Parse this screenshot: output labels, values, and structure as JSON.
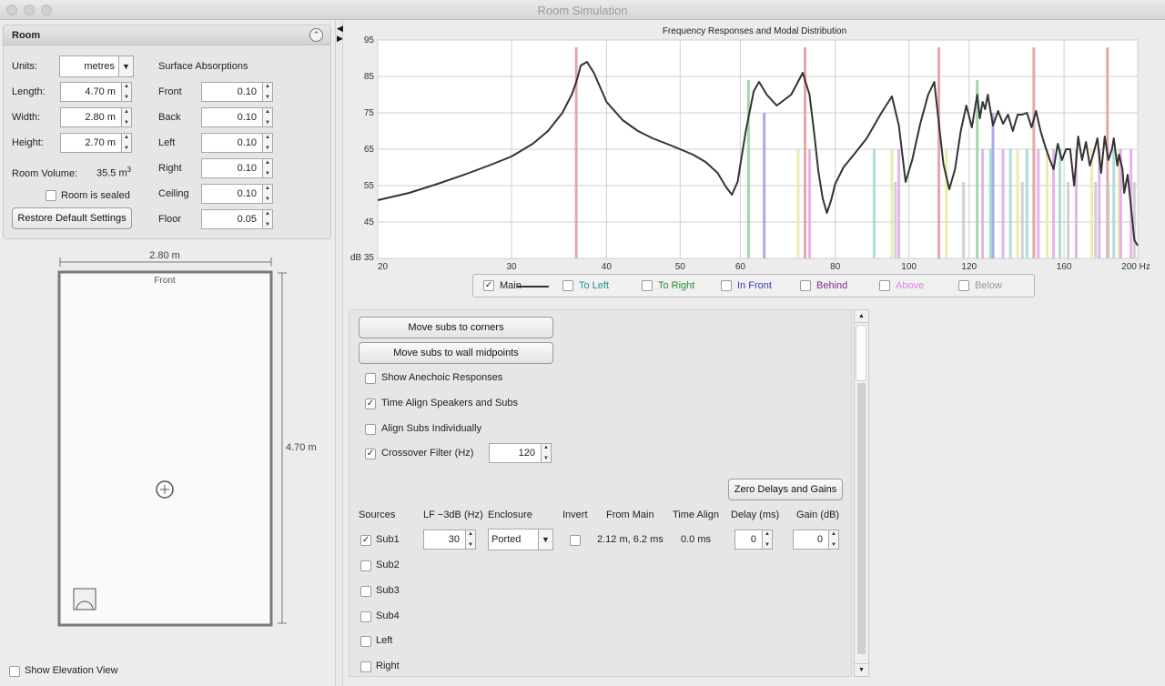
{
  "window": {
    "title": "Room Simulation"
  },
  "room": {
    "header": "Room",
    "units_label": "Units:",
    "units_value": "metres",
    "length_label": "Length:",
    "length_value": "4.70 m",
    "width_label": "Width:",
    "width_value": "2.80 m",
    "height_label": "Height:",
    "height_value": "2.70 m",
    "volume_label": "Room Volume:",
    "volume_value": "35.5 m",
    "volume_exp": "3",
    "sealed_label": "Room is sealed",
    "restore_label": "Restore Default Settings",
    "absorption_title": "Surface Absorptions",
    "surfaces": [
      {
        "label": "Front",
        "value": "0.10"
      },
      {
        "label": "Back",
        "value": "0.10"
      },
      {
        "label": "Left",
        "value": "0.10"
      },
      {
        "label": "Right",
        "value": "0.10"
      },
      {
        "label": "Ceiling",
        "value": "0.10"
      },
      {
        "label": "Floor",
        "value": "0.05"
      }
    ]
  },
  "plan": {
    "width_dim": "2.80 m",
    "length_dim": "4.70 m",
    "front_label": "Front",
    "elevation_label": "Show Elevation View"
  },
  "chart_data": {
    "type": "line",
    "title": "Frequency Responses and Modal Distribution",
    "xscale": "log",
    "xlim": [
      20,
      200
    ],
    "ylim": [
      35,
      95
    ],
    "x_ticks": [
      "20",
      "30",
      "40",
      "50",
      "60",
      "80",
      "100",
      "120",
      "160",
      "200 Hz"
    ],
    "x_tick_values": [
      20,
      30,
      40,
      50,
      60,
      80,
      100,
      120,
      160,
      200
    ],
    "y_ticks": [
      "dB 35",
      "45",
      "55",
      "65",
      "75",
      "85",
      "95"
    ],
    "y_tick_values": [
      35,
      45,
      55,
      65,
      75,
      85,
      95
    ],
    "grid": true,
    "series": [
      {
        "name": "Main",
        "x": [
          20,
          22,
          24,
          26,
          28,
          30,
          32,
          33.5,
          35,
          36,
          36.5,
          37,
          37.7,
          38.5,
          40,
          42,
          44,
          46,
          48,
          50,
          52,
          54,
          56,
          57.5,
          58.5,
          59.5,
          61,
          62.5,
          63.5,
          65,
          67,
          70,
          72.5,
          74,
          75,
          76,
          77,
          78,
          79,
          80,
          82,
          85,
          88,
          92,
          95,
          97,
          99,
          101,
          103.5,
          106,
          108,
          109.5,
          111,
          113,
          115,
          117,
          119,
          121,
          123,
          124,
          125,
          126,
          127,
          129,
          131,
          133,
          135,
          137,
          139,
          141,
          143,
          145,
          147,
          149,
          151,
          153,
          155,
          157,
          159,
          161,
          163,
          165,
          167,
          169,
          171,
          173,
          175,
          177,
          179,
          181,
          183,
          185,
          186,
          188,
          189,
          191,
          192,
          194,
          196,
          198,
          200
        ],
        "y": [
          51,
          53,
          55.5,
          58,
          60.5,
          63,
          66.5,
          70,
          75,
          80,
          83.5,
          88,
          89,
          86,
          78,
          73,
          70,
          68,
          66.5,
          65,
          63.5,
          61.5,
          58.5,
          54.5,
          52.5,
          56,
          70,
          81,
          83.5,
          80,
          77,
          80,
          86,
          80,
          70,
          59,
          51.5,
          47.5,
          51,
          55.5,
          60,
          64,
          68,
          75,
          79.5,
          71.5,
          56,
          62,
          72,
          80,
          83.5,
          72,
          61,
          54,
          59.5,
          70,
          77,
          71,
          80,
          73.5,
          78,
          76,
          80,
          71.5,
          75.5,
          72,
          74.5,
          70,
          74.5,
          74.5,
          75,
          71,
          75.5,
          70,
          66,
          62.5,
          59.5,
          66.5,
          62,
          65,
          65,
          55,
          68.5,
          62,
          67,
          60.5,
          64,
          68,
          58.5,
          68.5,
          62,
          65,
          68,
          60.5,
          63.5,
          59.5,
          53,
          58,
          49,
          40,
          38.5
        ]
      }
    ],
    "modal_lines": [
      {
        "color": "#e29a9a",
        "x": [
          36.5,
          73,
          109.5,
          146,
          182.5
        ]
      },
      {
        "color": "#93d19c",
        "x": [
          61.5,
          123
        ]
      },
      {
        "color": "#9c9ce6",
        "x": [
          64.5,
          129
        ]
      },
      {
        "color": "#ebe8a2",
        "x": [
          71.5,
          95,
          112,
          139,
          152,
          174,
          189
        ]
      },
      {
        "color": "#e1a7e8",
        "x": [
          74,
          97,
          125,
          133,
          148,
          155,
          166,
          178,
          190,
          196
        ]
      },
      {
        "color": "#9fd9d3",
        "x": [
          90,
          128,
          136,
          143,
          158,
          186
        ]
      },
      {
        "color": "#c9c9c9",
        "x": [
          96,
          118,
          141,
          162,
          176,
          183,
          198
        ]
      }
    ],
    "legend": [
      {
        "label": "Main",
        "checked": true,
        "color": "#333333"
      },
      {
        "label": "To Left",
        "checked": false,
        "color": "#2a8a9a"
      },
      {
        "label": "To Right",
        "checked": false,
        "color": "#2a8a3a"
      },
      {
        "label": "In Front",
        "checked": false,
        "color": "#3a3ab8"
      },
      {
        "label": "Behind",
        "checked": false,
        "color": "#8a2a9a"
      },
      {
        "label": "Above",
        "checked": false,
        "color": "#e085e8"
      },
      {
        "label": "Below",
        "checked": false,
        "color": "#9a9a9a"
      }
    ]
  },
  "controls": {
    "move_corners": "Move subs to corners",
    "move_midpoints": "Move subs to wall midpoints",
    "show_anechoic": "Show Anechoic Responses",
    "time_align": "Time Align Speakers and Subs",
    "align_individually": "Align Subs Individually",
    "crossover_label": "Crossover Filter (Hz)",
    "crossover_value": "120",
    "zero_delays": "Zero Delays and Gains",
    "headers": {
      "sources": "Sources",
      "lf3db": "LF −3dB (Hz)",
      "enclosure": "Enclosure",
      "invert": "Invert",
      "from_main": "From Main",
      "time_align": "Time Align",
      "delay": "Delay (ms)",
      "gain": "Gain (dB)"
    },
    "sub1": {
      "label": "Sub1",
      "lf": "30",
      "enclosure": "Ported",
      "from_main": "2.12 m, 6.2 ms",
      "time_align": "0.0 ms",
      "delay": "0",
      "gain": "0"
    },
    "sources": [
      "Sub2",
      "Sub3",
      "Sub4",
      "Left",
      "Right"
    ]
  }
}
